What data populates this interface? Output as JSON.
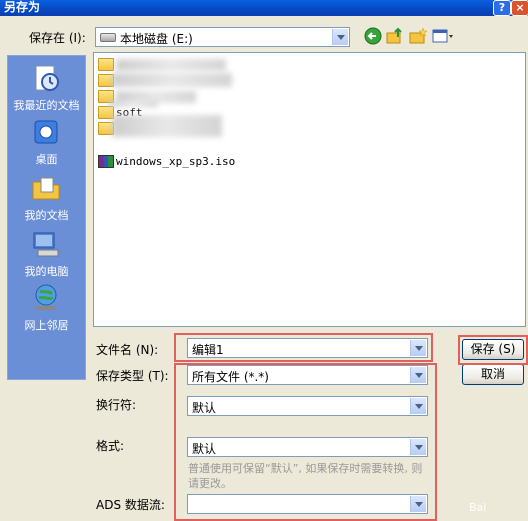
{
  "window": {
    "title": "另存为",
    "help_label": "?",
    "close_label": "×"
  },
  "save_in": {
    "label": "保存在 (I):",
    "value": "本地磁盘 (E:)"
  },
  "places": [
    {
      "label": "我最近的文档"
    },
    {
      "label": "桌面"
    },
    {
      "label": "我的文档"
    },
    {
      "label": "我的电脑"
    },
    {
      "label": "网上邻居"
    }
  ],
  "files": [
    {
      "name": "",
      "type": "folder",
      "blurred": true
    },
    {
      "name": "",
      "type": "folder",
      "blurred": true
    },
    {
      "name": "",
      "type": "folder",
      "blurred": true
    },
    {
      "name": "soft",
      "type": "folder",
      "blurred": true
    },
    {
      "name": "",
      "type": "folder",
      "blurred": true
    },
    {
      "name": "windows_xp_sp3.iso",
      "type": "archive",
      "blurred": false
    }
  ],
  "filename": {
    "label": "文件名 (N):",
    "value": "编辑1"
  },
  "filetype": {
    "label": "保存类型 (T):",
    "value": "所有文件 (*.*)"
  },
  "newline": {
    "label": "换行符:",
    "value": "默认"
  },
  "format": {
    "label": "格式:",
    "value": "默认",
    "hint": "普通使用可保留“默认”, 如果保存时需要转换, 则请更改。"
  },
  "ads": {
    "label": "ADS 数据流:",
    "value": ""
  },
  "buttons": {
    "save": "保存 (S)",
    "cancel": "取消"
  },
  "watermark": "Bai"
}
